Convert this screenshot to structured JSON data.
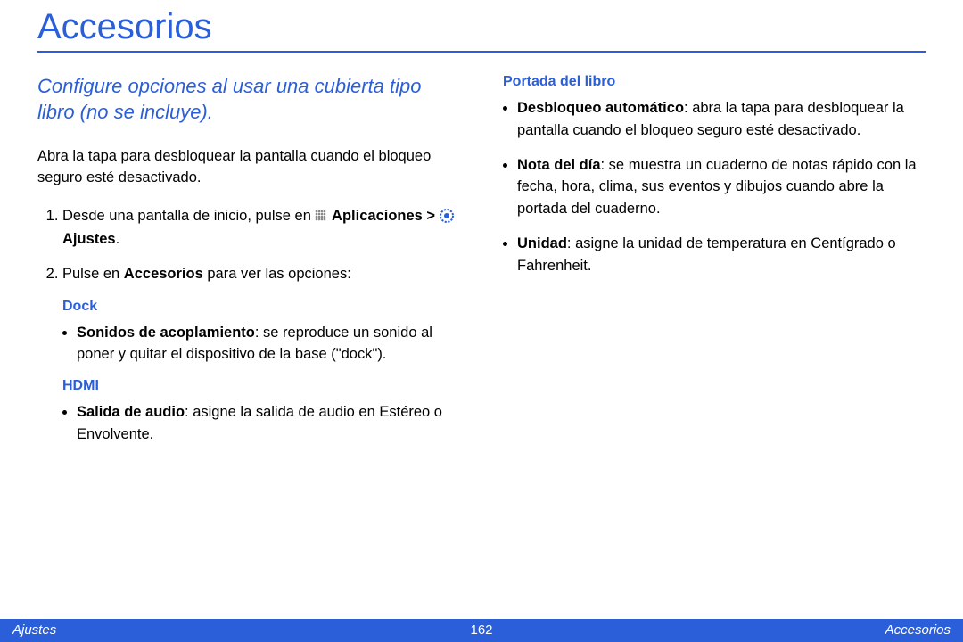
{
  "title": "Accesorios",
  "subtitle": "Configure opciones al usar una cubierta tipo libro (no se incluye).",
  "intro": "Abra la tapa para desbloquear la pantalla cuando el bloqueo seguro esté desactivado.",
  "step1_pre": "Desde una pantalla de inicio, pulse en ",
  "step1_apps": "Aplicaciones > ",
  "step1_ajustes": " Ajustes",
  "step1_period": ".",
  "step2_pre": "Pulse en ",
  "step2_bold": "Accesorios",
  "step2_post": " para ver las opciones:",
  "dock_label": "Dock",
  "dock_item_bold": "Sonidos de acoplamiento",
  "dock_item_rest": ": se reproduce un sonido al poner y quitar el dispositivo de la base (\"dock\").",
  "hdmi_label": "HDMI",
  "hdmi_item_bold": "Salida de audio",
  "hdmi_item_rest": ": asigne la salida de audio en Estéreo o Envolvente.",
  "portada_label": "Portada del libro",
  "portada_1_bold": "Desbloqueo automático",
  "portada_1_rest": ": abra la tapa para desbloquear la pantalla cuando el bloqueo seguro esté desactivado.",
  "portada_2_bold": "Nota del día",
  "portada_2_rest": ": se muestra un cuaderno de notas rápido con la fecha, hora, clima, sus eventos y dibujos cuando abre la portada del cuaderno.",
  "portada_3_bold": "Unidad",
  "portada_3_rest": ": asigne la unidad de temperatura en Centígrado o Fahrenheit.",
  "footer_left": "Ajustes",
  "footer_center": "162",
  "footer_right": "Accesorios"
}
